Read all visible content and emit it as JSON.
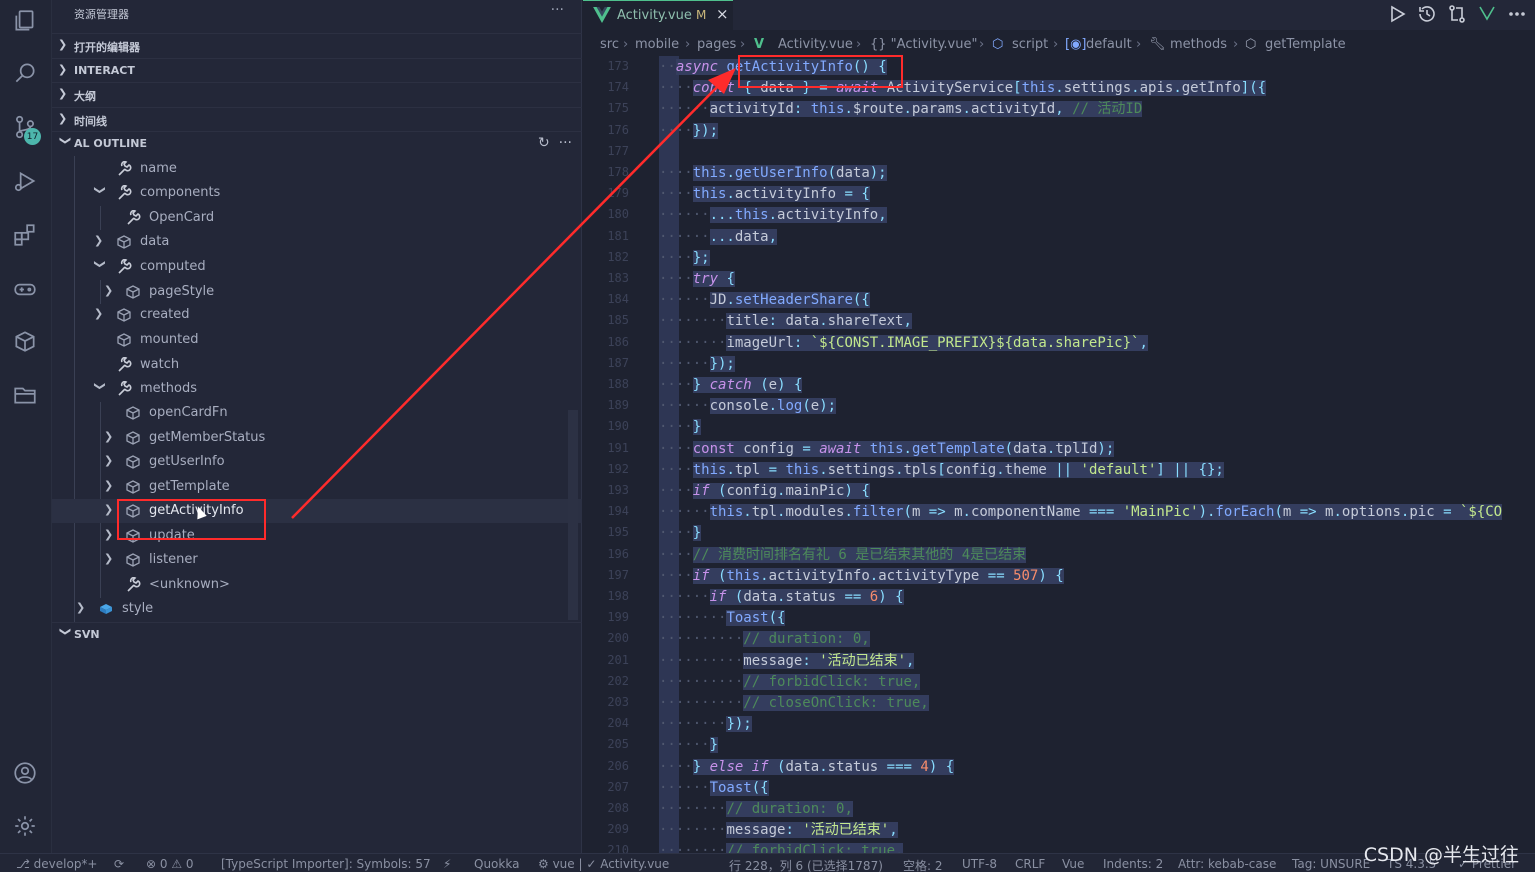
{
  "sidebar": {
    "title": "资源管理器",
    "more": "···",
    "sections": {
      "open_editors": "打开的编辑器",
      "interact": "INTERACT",
      "outline": "大纲",
      "timeline": "时间线",
      "al_outline": "AL OUTLINE",
      "svn": "SVN"
    },
    "tree": [
      {
        "label": "name"
      },
      {
        "label": "components"
      },
      {
        "label": "OpenCard"
      },
      {
        "label": "data"
      },
      {
        "label": "computed"
      },
      {
        "label": "pageStyle"
      },
      {
        "label": "created"
      },
      {
        "label": "mounted"
      },
      {
        "label": "watch"
      },
      {
        "label": "methods"
      },
      {
        "label": "openCardFn"
      },
      {
        "label": "getMemberStatus"
      },
      {
        "label": "getUserInfo"
      },
      {
        "label": "getTemplate"
      },
      {
        "label": "getActivityInfo"
      },
      {
        "label": "update"
      },
      {
        "label": "listener"
      },
      {
        "label": "<unknown>"
      },
      {
        "label": "style"
      }
    ],
    "scm_badge": "17"
  },
  "editor": {
    "tab": {
      "name": "Activity.vue",
      "modified": "M",
      "close": "×"
    },
    "breadcrumb": [
      "src",
      "mobile",
      "pages",
      "Activity.vue",
      "{} \"Activity.vue\"",
      "script",
      "default",
      "methods",
      "getTemplate"
    ],
    "line_numbers": [
      "173",
      "174",
      "175",
      "176",
      "177",
      "178",
      "179",
      "180",
      "181",
      "182",
      "183",
      "184",
      "185",
      "186",
      "187",
      "188",
      "189",
      "190",
      "191",
      "192",
      "193",
      "194",
      "195",
      "196",
      "197",
      "198",
      "199",
      "200",
      "201",
      "202",
      "203",
      "204",
      "205",
      "206",
      "207",
      "208",
      "209",
      "210"
    ]
  },
  "status": {
    "branch": "develop*+",
    "errors": "⊗ 0 ⚠ 0",
    "importer": "[TypeScript Importer]: Symbols: 57",
    "quokka": "Quokka",
    "vue": "vue | ✓ Activity.vue",
    "position": "行 228，列 6 (已选择1787)",
    "spaces": "空格: 2",
    "encoding": "UTF-8",
    "eol": "CRLF",
    "language": "Vue",
    "indents": "Indents: 2",
    "attr": "Attr: kebab-case",
    "tag": "Tag: UNSURE",
    "ts": "TS 4.3.5",
    "prettier": "Prettier"
  },
  "watermark": "CSDN @半生过往",
  "colors": {
    "accent": "#4fc08d",
    "highlight_box": "#ff2b2b"
  }
}
